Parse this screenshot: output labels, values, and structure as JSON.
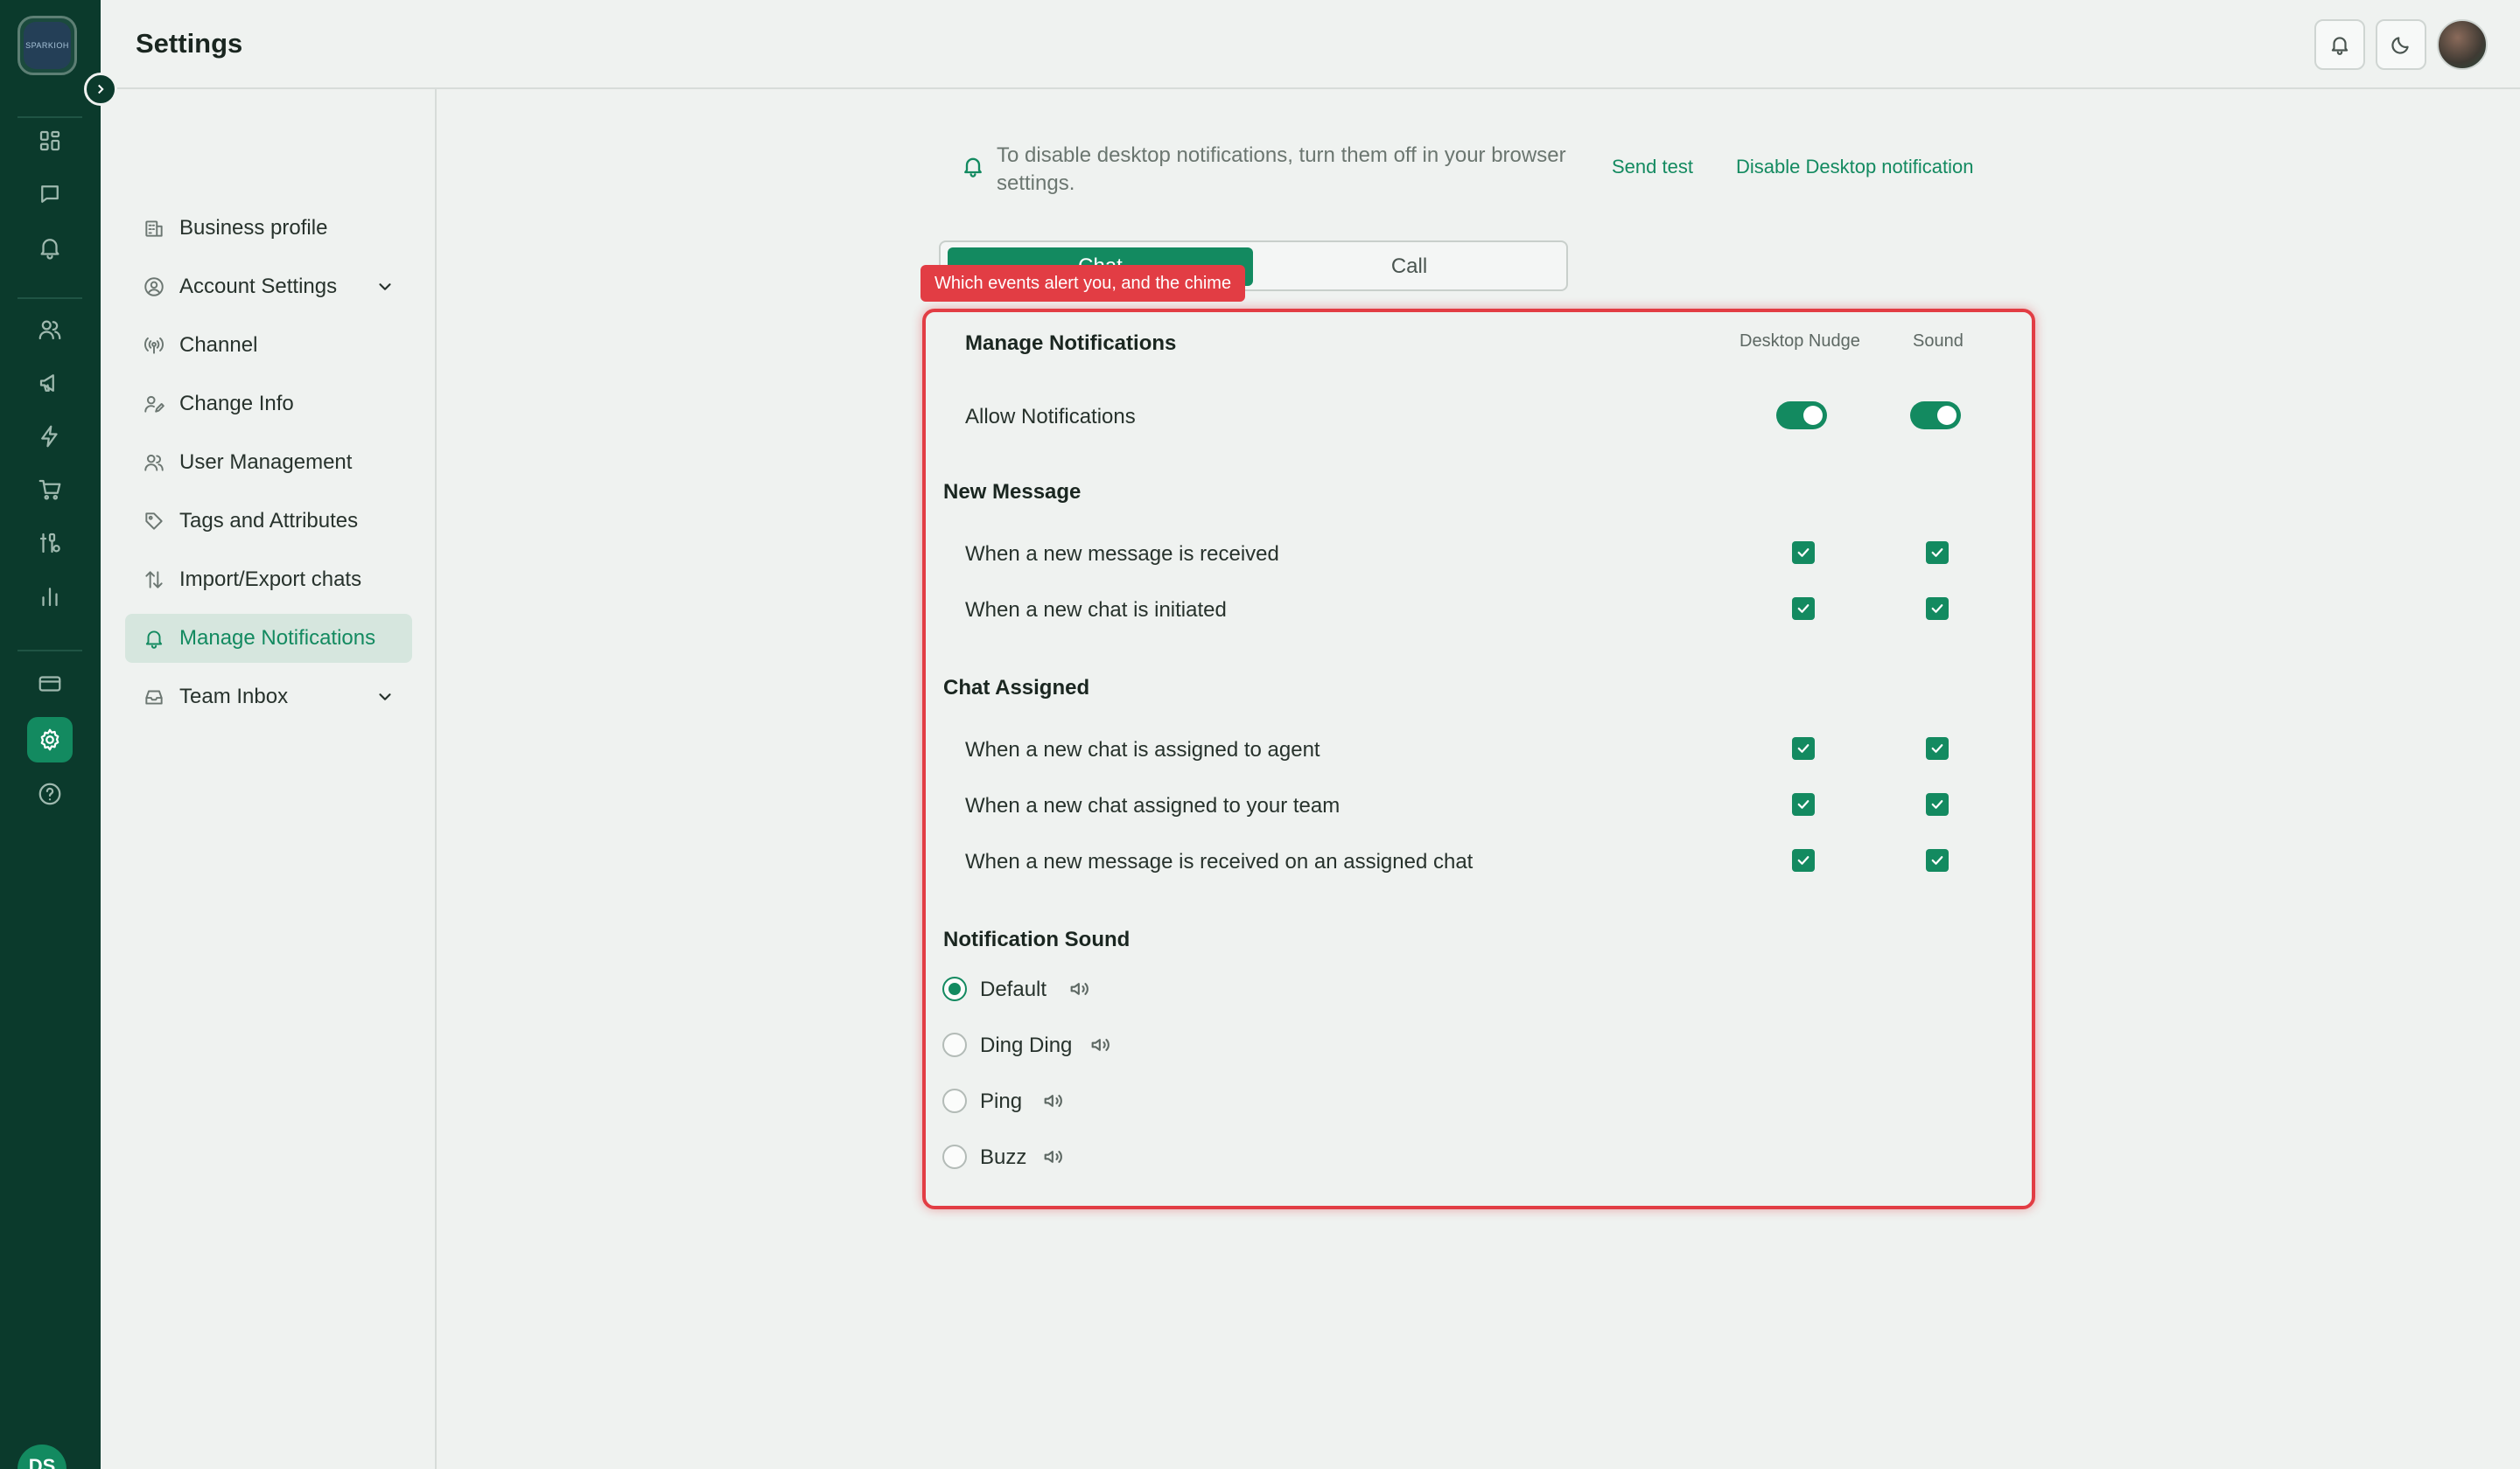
{
  "header": {
    "title": "Settings"
  },
  "rail": {
    "logo_text": "SPARKIOH",
    "avatar_initials": "DS",
    "icons": [
      "dashboard-icon",
      "chat-icon",
      "bell-icon",
      "contacts-icon",
      "megaphone-icon",
      "lightning-icon",
      "cart-icon",
      "integrations-icon",
      "analytics-icon",
      "billing-icon",
      "settings-icon",
      "help-icon"
    ]
  },
  "sidebar": {
    "items": [
      {
        "label": "Business profile",
        "icon": "building-icon"
      },
      {
        "label": "Account Settings",
        "icon": "user-circle-icon",
        "expandable": true
      },
      {
        "label": "Channel",
        "icon": "broadcast-icon"
      },
      {
        "label": "Change Info",
        "icon": "user-edit-icon"
      },
      {
        "label": "User Management",
        "icon": "users-icon"
      },
      {
        "label": "Tags and Attributes",
        "icon": "tag-icon"
      },
      {
        "label": "Import/Export chats",
        "icon": "import-export-icon"
      },
      {
        "label": "Manage Notifications",
        "icon": "bell-icon",
        "active": true
      },
      {
        "label": "Team Inbox",
        "icon": "inbox-icon",
        "expandable": true
      }
    ]
  },
  "info": {
    "text": "To disable desktop notifications, turn them off in your browser settings.",
    "send_test": "Send test",
    "disable_desktop": "Disable Desktop notification"
  },
  "tabs": {
    "chat": "Chat",
    "call": "Call",
    "active": "Chat"
  },
  "callout": "Which events alert you, and the chime",
  "panel": {
    "title": "Manage Notifications",
    "col_desktop": "Desktop Nudge",
    "col_sound": "Sound",
    "allow_label": "Allow Notifications",
    "allow_desktop": true,
    "allow_sound": true,
    "new_message": {
      "title": "New Message",
      "rows": [
        {
          "label": "When a new message is received",
          "desktop": true,
          "sound": true
        },
        {
          "label": "When a new chat is initiated",
          "desktop": true,
          "sound": true
        }
      ]
    },
    "chat_assigned": {
      "title": "Chat Assigned",
      "rows": [
        {
          "label": "When a new chat is assigned to agent",
          "desktop": true,
          "sound": true
        },
        {
          "label": "When a new chat assigned to your team",
          "desktop": true,
          "sound": true
        },
        {
          "label": "When a new message is received on an assigned chat",
          "desktop": true,
          "sound": true
        }
      ]
    },
    "sound": {
      "title": "Notification Sound",
      "selected": "Default",
      "options": [
        "Default",
        "Ding Ding",
        "Ping",
        "Buzz"
      ]
    }
  },
  "colors": {
    "brand": "#138a60",
    "rail": "#0b3a2c",
    "highlight": "#e23d44"
  }
}
